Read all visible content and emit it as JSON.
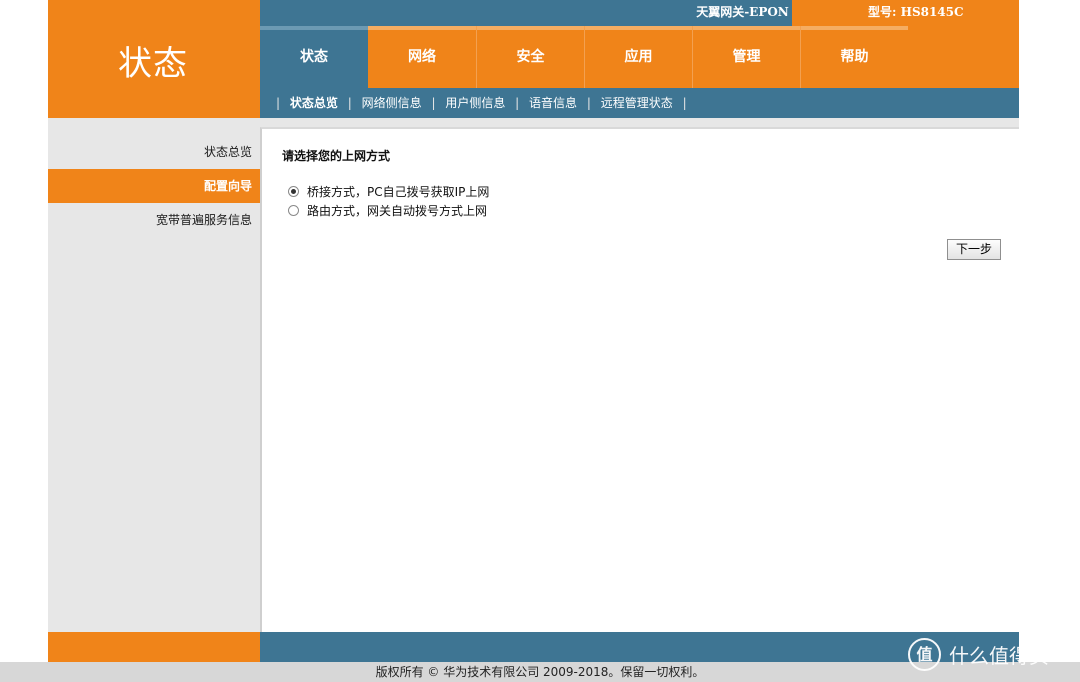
{
  "header": {
    "logo_text": "状态",
    "brand": "天翼网关-EPON",
    "model": "型号: HS8145C"
  },
  "tabs": [
    {
      "label": "状态",
      "active": true
    },
    {
      "label": "网络",
      "active": false
    },
    {
      "label": "安全",
      "active": false
    },
    {
      "label": "应用",
      "active": false
    },
    {
      "label": "管理",
      "active": false
    },
    {
      "label": "帮助",
      "active": false
    }
  ],
  "subnav": [
    {
      "label": "状态总览",
      "active": true
    },
    {
      "label": "网络侧信息",
      "active": false
    },
    {
      "label": "用户侧信息",
      "active": false
    },
    {
      "label": "语音信息",
      "active": false
    },
    {
      "label": "远程管理状态",
      "active": false
    }
  ],
  "sidebar": [
    {
      "label": "状态总览",
      "active": false
    },
    {
      "label": "配置向导",
      "active": true
    },
    {
      "label": "宽带普遍服务信息",
      "active": false
    }
  ],
  "main": {
    "title": "请选择您的上网方式",
    "options": [
      {
        "label": "桥接方式，PC自己拨号获取IP上网",
        "checked": true
      },
      {
        "label": "路由方式，网关自动拨号方式上网",
        "checked": false
      }
    ],
    "next_label": "下一步"
  },
  "footer": {
    "copyright": "版权所有 © 华为技术有限公司 2009-2018。保留一切权利。"
  },
  "watermark": {
    "icon": "值",
    "text": "什么值得买"
  },
  "colors": {
    "orange": "#f08419",
    "blue": "#3e7593",
    "sidebar_bg": "#e7e7e7"
  }
}
